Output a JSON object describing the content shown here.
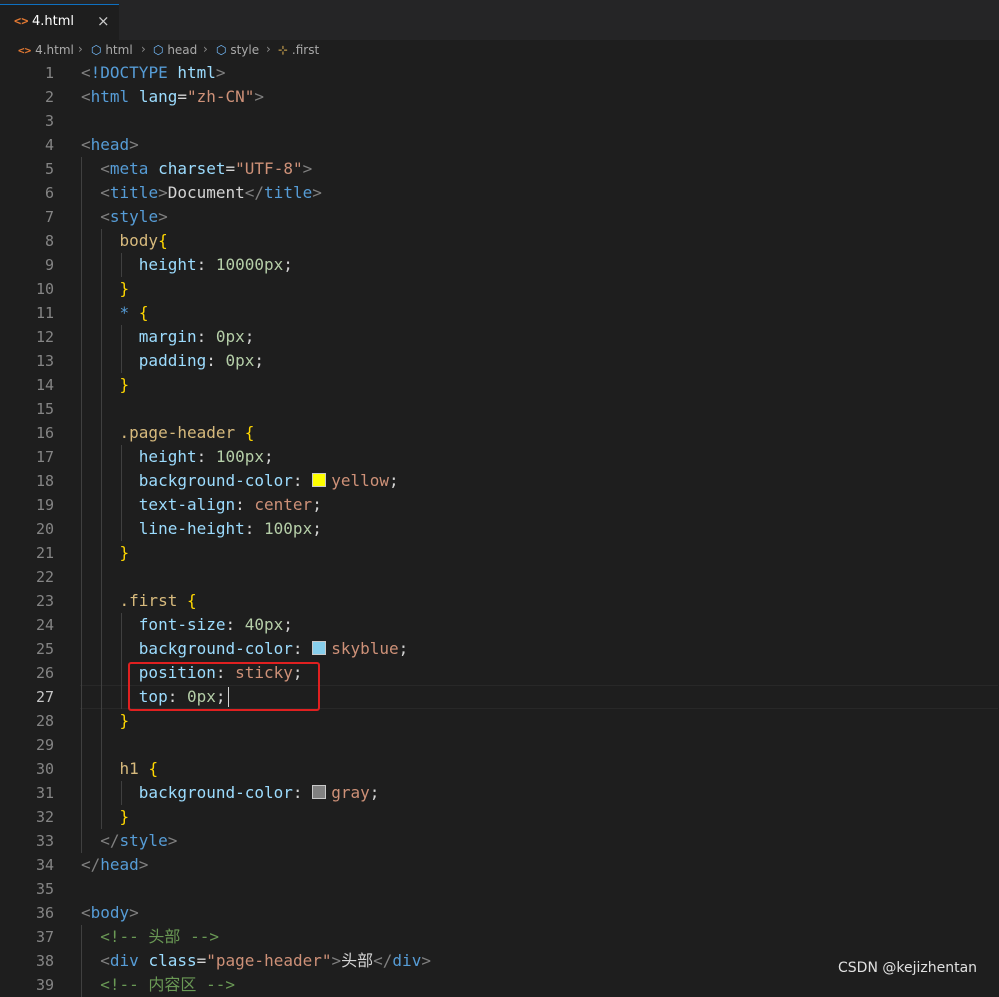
{
  "tab": {
    "icon": "html-file-icon",
    "label": "4.html",
    "close": "×"
  },
  "breadcrumb": {
    "items": [
      {
        "label": "4.html",
        "icon": "<>"
      },
      {
        "label": "html",
        "icon": "⬡"
      },
      {
        "label": "head",
        "icon": "⬡"
      },
      {
        "label": "style",
        "icon": "⬡"
      },
      {
        "label": ".first",
        "icon": "⊹"
      }
    ],
    "separator": "›"
  },
  "code": {
    "active_line": "27",
    "lines": [
      {
        "n": "1",
        "t": [
          [
            "punc",
            "<"
          ],
          [
            "tag",
            "!DOCTYPE"
          ],
          [
            "text",
            " "
          ],
          [
            "attr",
            "html"
          ],
          [
            "punc",
            ">"
          ]
        ]
      },
      {
        "n": "2",
        "t": [
          [
            "punc",
            "<"
          ],
          [
            "tag",
            "html"
          ],
          [
            "text",
            " "
          ],
          [
            "attr",
            "lang"
          ],
          [
            "text",
            "="
          ],
          [
            "str",
            "\"zh-CN\""
          ],
          [
            "punc",
            ">"
          ]
        ]
      },
      {
        "n": "3",
        "t": []
      },
      {
        "n": "4",
        "t": [
          [
            "punc",
            "<"
          ],
          [
            "tag",
            "head"
          ],
          [
            "punc",
            ">"
          ]
        ]
      },
      {
        "n": "5",
        "t": [
          [
            "text",
            "  "
          ],
          [
            "punc",
            "<"
          ],
          [
            "tag",
            "meta"
          ],
          [
            "text",
            " "
          ],
          [
            "attr",
            "charset"
          ],
          [
            "text",
            "="
          ],
          [
            "str",
            "\"UTF-8\""
          ],
          [
            "punc",
            ">"
          ]
        ]
      },
      {
        "n": "6",
        "t": [
          [
            "text",
            "  "
          ],
          [
            "punc",
            "<"
          ],
          [
            "tag",
            "title"
          ],
          [
            "punc",
            ">"
          ],
          [
            "text",
            "Document"
          ],
          [
            "punc",
            "</"
          ],
          [
            "tag",
            "title"
          ],
          [
            "punc",
            ">"
          ]
        ]
      },
      {
        "n": "7",
        "t": [
          [
            "text",
            "  "
          ],
          [
            "punc",
            "<"
          ],
          [
            "tag",
            "style"
          ],
          [
            "punc",
            ">"
          ]
        ]
      },
      {
        "n": "8",
        "t": [
          [
            "text",
            "    "
          ],
          [
            "sel",
            "body"
          ],
          [
            "brace",
            "{"
          ]
        ]
      },
      {
        "n": "9",
        "t": [
          [
            "text",
            "      "
          ],
          [
            "prop",
            "height"
          ],
          [
            "text",
            ": "
          ],
          [
            "num",
            "10000px"
          ],
          [
            "text",
            ";"
          ]
        ]
      },
      {
        "n": "10",
        "t": [
          [
            "text",
            "    "
          ],
          [
            "brace",
            "}"
          ]
        ]
      },
      {
        "n": "11",
        "t": [
          [
            "text",
            "    "
          ],
          [
            "kw",
            "*"
          ],
          [
            "text",
            " "
          ],
          [
            "brace",
            "{"
          ]
        ]
      },
      {
        "n": "12",
        "t": [
          [
            "text",
            "      "
          ],
          [
            "prop",
            "margin"
          ],
          [
            "text",
            ": "
          ],
          [
            "num",
            "0px"
          ],
          [
            "text",
            ";"
          ]
        ]
      },
      {
        "n": "13",
        "t": [
          [
            "text",
            "      "
          ],
          [
            "prop",
            "padding"
          ],
          [
            "text",
            ": "
          ],
          [
            "num",
            "0px"
          ],
          [
            "text",
            ";"
          ]
        ]
      },
      {
        "n": "14",
        "t": [
          [
            "text",
            "    "
          ],
          [
            "brace",
            "}"
          ]
        ]
      },
      {
        "n": "15",
        "t": []
      },
      {
        "n": "16",
        "t": [
          [
            "text",
            "    "
          ],
          [
            "sel",
            ".page-header"
          ],
          [
            "text",
            " "
          ],
          [
            "brace",
            "{"
          ]
        ]
      },
      {
        "n": "17",
        "t": [
          [
            "text",
            "      "
          ],
          [
            "prop",
            "height"
          ],
          [
            "text",
            ": "
          ],
          [
            "num",
            "100px"
          ],
          [
            "text",
            ";"
          ]
        ]
      },
      {
        "n": "18",
        "t": [
          [
            "text",
            "      "
          ],
          [
            "prop",
            "background-color"
          ],
          [
            "text",
            ": "
          ],
          [
            "swatch",
            "#ffff00"
          ],
          [
            "val",
            "yellow"
          ],
          [
            "text",
            ";"
          ]
        ]
      },
      {
        "n": "19",
        "t": [
          [
            "text",
            "      "
          ],
          [
            "prop",
            "text-align"
          ],
          [
            "text",
            ": "
          ],
          [
            "val",
            "center"
          ],
          [
            "text",
            ";"
          ]
        ]
      },
      {
        "n": "20",
        "t": [
          [
            "text",
            "      "
          ],
          [
            "prop",
            "line-height"
          ],
          [
            "text",
            ": "
          ],
          [
            "num",
            "100px"
          ],
          [
            "text",
            ";"
          ]
        ]
      },
      {
        "n": "21",
        "t": [
          [
            "text",
            "    "
          ],
          [
            "brace",
            "}"
          ]
        ]
      },
      {
        "n": "22",
        "t": []
      },
      {
        "n": "23",
        "t": [
          [
            "text",
            "    "
          ],
          [
            "sel",
            ".first"
          ],
          [
            "text",
            " "
          ],
          [
            "brace",
            "{"
          ]
        ]
      },
      {
        "n": "24",
        "t": [
          [
            "text",
            "      "
          ],
          [
            "prop",
            "font-size"
          ],
          [
            "text",
            ": "
          ],
          [
            "num",
            "40px"
          ],
          [
            "text",
            ";"
          ]
        ]
      },
      {
        "n": "25",
        "t": [
          [
            "text",
            "      "
          ],
          [
            "prop",
            "background-color"
          ],
          [
            "text",
            ": "
          ],
          [
            "swatch",
            "#87ceeb"
          ],
          [
            "val",
            "skyblue"
          ],
          [
            "text",
            ";"
          ]
        ]
      },
      {
        "n": "26",
        "t": [
          [
            "text",
            "      "
          ],
          [
            "prop",
            "position"
          ],
          [
            "text",
            ": "
          ],
          [
            "val",
            "sticky"
          ],
          [
            "text",
            ";"
          ]
        ]
      },
      {
        "n": "27",
        "t": [
          [
            "text",
            "      "
          ],
          [
            "prop",
            "top"
          ],
          [
            "text",
            ": "
          ],
          [
            "num",
            "0px"
          ],
          [
            "text",
            ";"
          ]
        ]
      },
      {
        "n": "28",
        "t": [
          [
            "text",
            "    "
          ],
          [
            "brace",
            "}"
          ]
        ]
      },
      {
        "n": "29",
        "t": []
      },
      {
        "n": "30",
        "t": [
          [
            "text",
            "    "
          ],
          [
            "sel",
            "h1"
          ],
          [
            "text",
            " "
          ],
          [
            "brace",
            "{"
          ]
        ]
      },
      {
        "n": "31",
        "t": [
          [
            "text",
            "      "
          ],
          [
            "prop",
            "background-color"
          ],
          [
            "text",
            ": "
          ],
          [
            "swatch",
            "#808080"
          ],
          [
            "val",
            "gray"
          ],
          [
            "text",
            ";"
          ]
        ]
      },
      {
        "n": "32",
        "t": [
          [
            "text",
            "    "
          ],
          [
            "brace",
            "}"
          ]
        ]
      },
      {
        "n": "33",
        "t": [
          [
            "text",
            "  "
          ],
          [
            "punc",
            "</"
          ],
          [
            "tag",
            "style"
          ],
          [
            "punc",
            ">"
          ]
        ]
      },
      {
        "n": "34",
        "t": [
          [
            "punc",
            "</"
          ],
          [
            "tag",
            "head"
          ],
          [
            "punc",
            ">"
          ]
        ]
      },
      {
        "n": "35",
        "t": []
      },
      {
        "n": "36",
        "t": [
          [
            "punc",
            "<"
          ],
          [
            "tag",
            "body"
          ],
          [
            "punc",
            ">"
          ]
        ]
      },
      {
        "n": "37",
        "t": [
          [
            "text",
            "  "
          ],
          [
            "com",
            "<!-- 头部 -->"
          ]
        ]
      },
      {
        "n": "38",
        "t": [
          [
            "text",
            "  "
          ],
          [
            "punc",
            "<"
          ],
          [
            "tag",
            "div"
          ],
          [
            "text",
            " "
          ],
          [
            "attr",
            "class"
          ],
          [
            "text",
            "="
          ],
          [
            "str",
            "\"page-header\""
          ],
          [
            "punc",
            ">"
          ],
          [
            "text",
            "头部"
          ],
          [
            "punc",
            "</"
          ],
          [
            "tag",
            "div"
          ],
          [
            "punc",
            ">"
          ]
        ]
      },
      {
        "n": "39",
        "t": [
          [
            "text",
            "  "
          ],
          [
            "com",
            "<!-- 内容区 -->"
          ]
        ]
      }
    ]
  },
  "watermark": "CSDN @kejizhentan"
}
